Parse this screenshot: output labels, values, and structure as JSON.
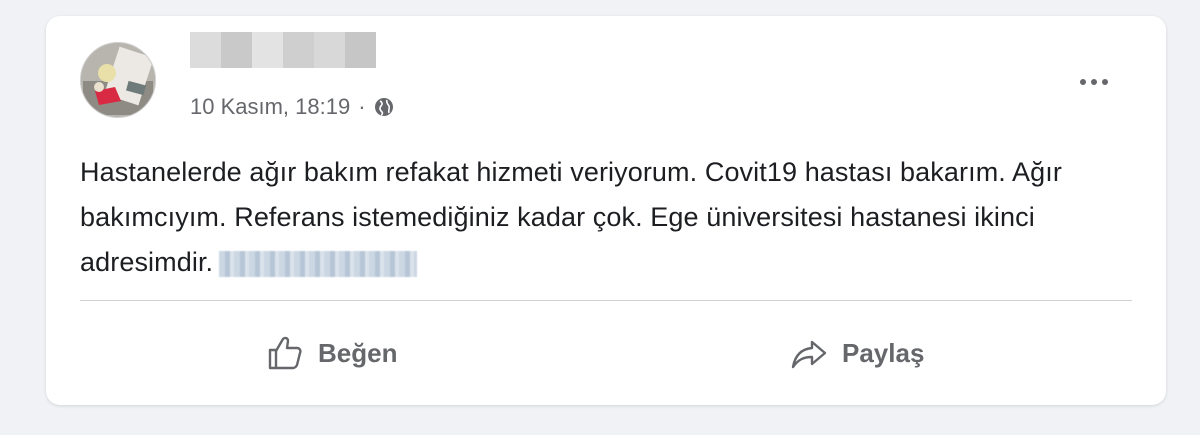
{
  "post": {
    "author_name": "",
    "timestamp": "10 Kasım, 18:19",
    "separator": "·",
    "privacy_icon": "globe-icon",
    "text": "Hastanelerde ağır bakım refakat hizmeti veriyorum. Covit19 hastası bakarım. Ağır bakımcıyım. Referans istemediğiniz kadar çok. Ege üniversitesi hastanesi ikinci adresimdir.",
    "phone_redacted": true
  },
  "menu": {
    "more_icon": "more-horizontal-icon"
  },
  "actions": {
    "like_label": "Beğen",
    "like_icon": "thumbs-up-icon",
    "share_label": "Paylaş",
    "share_icon": "share-arrow-icon"
  },
  "colors": {
    "background": "#f0f2f5",
    "card": "#ffffff",
    "text_primary": "#1c1e21",
    "text_secondary": "#65676b",
    "divider": "#ced0d4"
  }
}
